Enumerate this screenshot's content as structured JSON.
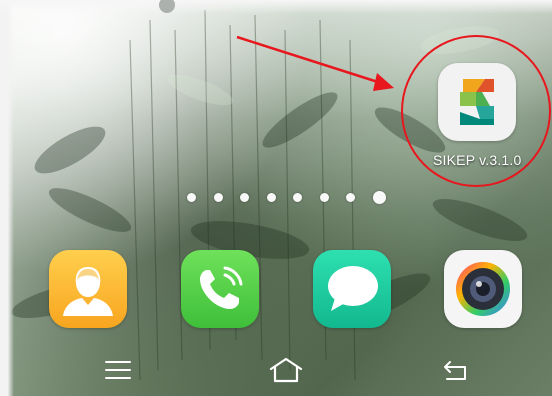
{
  "home_screen": {
    "apps": [
      {
        "label": "SIKEP v.3.1.0",
        "icon": "sikep-s-logo-icon"
      }
    ],
    "page_indicator": {
      "count": 8,
      "active_index": 7
    },
    "dock": [
      {
        "icon": "contacts-icon"
      },
      {
        "icon": "phone-icon"
      },
      {
        "icon": "messages-icon"
      },
      {
        "icon": "camera-icon"
      }
    ]
  },
  "navigation_bar": {
    "buttons": [
      {
        "icon": "menu-icon"
      },
      {
        "icon": "home-icon"
      },
      {
        "icon": "back-icon"
      }
    ]
  },
  "annotation": {
    "color": "#e8161d",
    "shapes": [
      "circle",
      "arrow"
    ]
  }
}
